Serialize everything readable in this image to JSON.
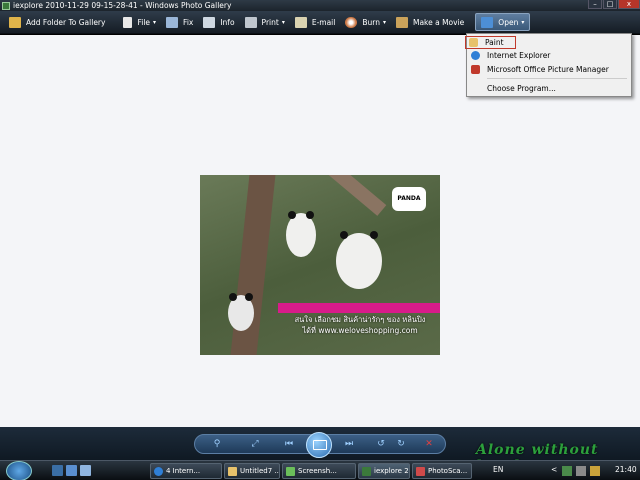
{
  "window": {
    "title": "iexplore 2010-11-29 09-15-28-41 - Windows Photo Gallery",
    "controls": {
      "minimize": "–",
      "maximize": "□",
      "close": "x"
    }
  },
  "toolbar": {
    "items": [
      {
        "label": "Add Folder To Gallery",
        "icon": "add-folder-icon",
        "arrow": ""
      },
      {
        "label": "File",
        "icon": "file-icon",
        "arrow": "▾"
      },
      {
        "label": "Fix",
        "icon": "fix-icon",
        "arrow": ""
      },
      {
        "label": "Info",
        "icon": "info-icon",
        "arrow": ""
      },
      {
        "label": "Print",
        "icon": "printer-icon",
        "arrow": "▾"
      },
      {
        "label": "E-mail",
        "icon": "email-icon",
        "arrow": ""
      },
      {
        "label": "Burn",
        "icon": "burn-disc-icon",
        "arrow": "▾"
      },
      {
        "label": "Make a Movie",
        "icon": "movie-icon",
        "arrow": ""
      },
      {
        "label": "Open",
        "icon": "open-icon",
        "arrow": "▾"
      }
    ]
  },
  "open_menu": {
    "items": [
      {
        "label": "Paint",
        "icon": "paint-icon"
      },
      {
        "label": "Internet Explorer",
        "icon": "internet-explorer-icon"
      },
      {
        "label": "Microsoft Office Picture Manager",
        "icon": "picture-manager-icon"
      },
      {
        "label": "Choose Program...",
        "icon": ""
      }
    ]
  },
  "photo": {
    "caption_line1": "สนใจ เลือกชม สินค้าน่ารักๆ ของ หลินปิง",
    "caption_line2": "ได้ที่ www.weloveshopping.com",
    "logo_text": "PANDA"
  },
  "playback": {
    "buttons": [
      {
        "name": "zoom-button",
        "glyph": "⚲"
      },
      {
        "name": "actual-size-button",
        "glyph": "⤢"
      },
      {
        "name": "previous-button",
        "glyph": "⏮"
      },
      {
        "name": "next-button",
        "glyph": "⏭"
      },
      {
        "name": "rotate-ccw-button",
        "glyph": "↺"
      },
      {
        "name": "rotate-cw-button",
        "glyph": "↻"
      },
      {
        "name": "delete-button",
        "glyph": "✕"
      }
    ]
  },
  "watermark": "Alone without lonely",
  "taskbar": {
    "tasks": [
      {
        "label": "4 Intern...",
        "icon": "internet-explorer-icon"
      },
      {
        "label": "Untitled7 ...",
        "icon": "paint-icon"
      },
      {
        "label": "Screensh...",
        "icon": "screenshot-icon"
      },
      {
        "label": "iexplore 2...",
        "icon": "photo-gallery-icon"
      },
      {
        "label": "PhotoSca...",
        "icon": "photoscape-icon"
      }
    ],
    "language": "EN",
    "clock": "21:40",
    "tray_arrow": "<"
  },
  "colors": {
    "toolbar_dark": "#1c242c",
    "content_bg": "#f4f5f8",
    "banner_pink": "#d81b8a",
    "watermark_green": "#2ca03c",
    "menu_highlight": "#c0392b"
  }
}
